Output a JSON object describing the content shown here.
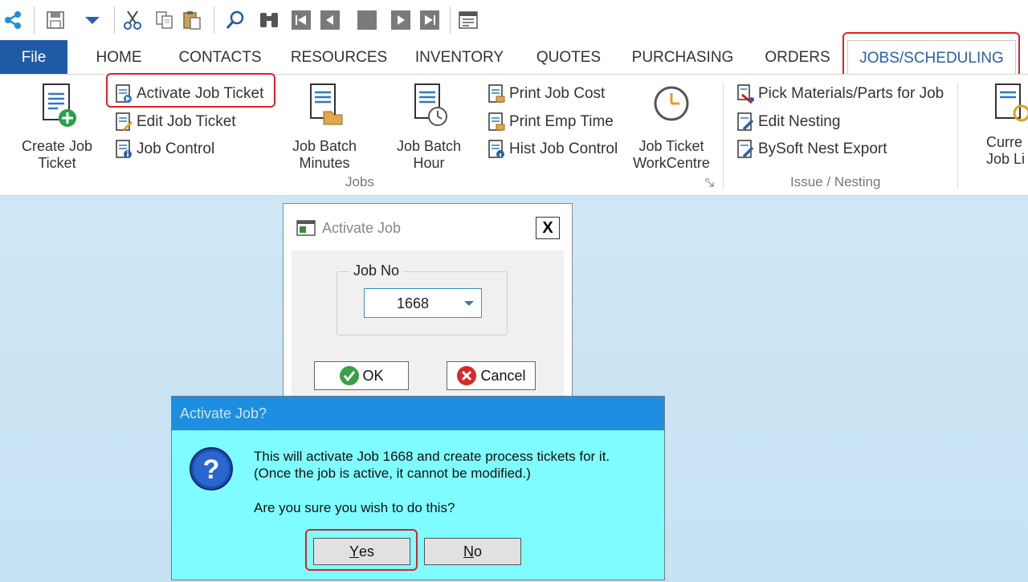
{
  "quick_access": {
    "icons": [
      "app-logo-icon",
      "save-icon",
      "dropdown-arrow-icon",
      "cut-icon",
      "copy-icon",
      "paste-icon",
      "search-icon",
      "binoculars-icon",
      "first-record-icon",
      "previous-record-icon",
      "stop-icon",
      "next-record-icon",
      "last-record-icon",
      "form-view-icon"
    ]
  },
  "tabs": {
    "file": "File",
    "items": [
      "HOME",
      "CONTACTS",
      "RESOURCES",
      "INVENTORY",
      "QUOTES",
      "PURCHASING",
      "ORDERS",
      "JOBS/SCHEDULING"
    ],
    "active": "JOBS/SCHEDULING"
  },
  "ribbon": {
    "create_job_ticket": "Create Job\nTicket",
    "activate_job_ticket": "Activate Job Ticket",
    "edit_job_ticket": "Edit Job Ticket",
    "job_control": "Job Control",
    "job_batch_minutes": "Job Batch\nMinutes",
    "job_batch_hour": "Job Batch\nHour",
    "print_job_cost": "Print Job Cost",
    "print_emp_time": "Print Emp Time",
    "hist_job_control": "Hist Job Control",
    "job_ticket_workcentre": "Job Ticket\nWorkCentre",
    "group_jobs": "Jobs",
    "pick_materials": "Pick Materials/Parts for Job",
    "edit_nesting": "Edit Nesting",
    "bysoft_nest_export": "BySoft Nest Export",
    "group_issue": "Issue / Nesting",
    "current_job_list": "Curre\nJob Li"
  },
  "activate_dialog": {
    "title": "Activate Job",
    "close": "X",
    "job_no_label": "Job No",
    "job_no_value": "1668",
    "ok": "OK",
    "cancel": "Cancel"
  },
  "confirm_dialog": {
    "title": "Activate Job?",
    "line1": "This will activate Job 1668 and create process tickets for it.",
    "line2": " (Once the job is active, it cannot be modified.)",
    "line3": "Are you sure you wish to do this?",
    "yes_key": "Y",
    "yes_rest": "es",
    "no_key": "N",
    "no_rest": "o"
  },
  "colors": {
    "file_tab": "#1e5aa6",
    "active_tab_text": "#2b5fb0",
    "highlight": "#e0202a",
    "confirm_bg": "#7ffcff",
    "confirm_title": "#1e8fe0",
    "desktop": "#cfe6f5"
  }
}
